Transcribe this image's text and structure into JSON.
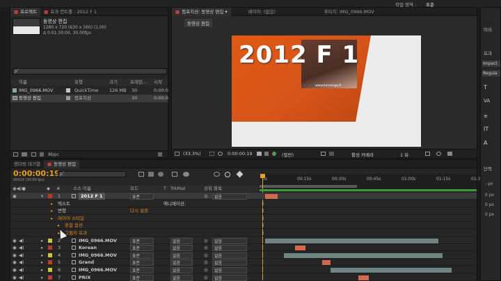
{
  "top_menu": {
    "workspace_label": "작업 영역 :",
    "workspace_value": "표준"
  },
  "project_panel": {
    "tabs": [
      "프로젝트",
      "효과 컨트롤 : 2012 F 1"
    ],
    "comp_name": "동영상 편집",
    "comp_dims": "1280 x 720  (630 x 360) (1.00)",
    "comp_duration": "Δ 0:01:30:00, 30.00fps",
    "search_placeholder": "ρ˜",
    "columns": [
      "이름",
      "유형",
      "크기",
      "프레임...",
      "시작"
    ],
    "items": [
      {
        "name": "IMG_0966.MOV",
        "type": "QuickTime",
        "size": "126 MB",
        "fps": "30",
        "start": "0:00:0"
      },
      {
        "name": "동영상 편집",
        "type": "컴포지션",
        "size": "",
        "fps": "30",
        "start": "0:00:0"
      }
    ],
    "bpc": "8bpc"
  },
  "viewer_panel": {
    "tabs": [
      "컴포지션: 동영상 편집",
      "레이어: (없음)",
      "푸티지: IMG_0966.MOV"
    ],
    "breadcrumb": "동영상 편집",
    "frame_title": "2012 F 1",
    "frame_url": "www.koreanga.fr",
    "zoom": "(33.3%)",
    "timecode": "0:00:00:19",
    "resolution": "(절반)",
    "camera": "활성 카메라",
    "views": "1 뷰"
  },
  "right_panel": {
    "top_tabs": [
      "미리"
    ],
    "effects_tab": "효과",
    "items": [
      "Impact",
      "Regula"
    ],
    "bottom_tab": "단락",
    "px_values": [
      "- px",
      "0 px",
      "0 px",
      "0 px"
    ]
  },
  "timeline": {
    "tabs": [
      "렌더링 대기열",
      "동영상 편집"
    ],
    "timecode": "0:00:00:19",
    "timecode_sub": "00019 (30.00 fps)",
    "search_placeholder": "ρ˜",
    "columns": {
      "num": "#",
      "name": "소스 이름",
      "mode": "모드",
      "t": "T",
      "trkmat": "TrkMat",
      "parent": "상위 항목"
    },
    "ruler_ticks": [
      "0s",
      "00:15s",
      "00:30s",
      "00:45s",
      "01:00s",
      "01:15s",
      "01:3"
    ],
    "rows": [
      {
        "num": "1",
        "name": "2012 F 1",
        "kind": "layer",
        "color": "#c0392b",
        "mode": "표준",
        "trkmat": "",
        "parent": "없음",
        "bar_start": 0.0,
        "bar_end": 0.06,
        "bar_color": "#d4694b"
      },
      {
        "num": "",
        "name": "텍스트",
        "kind": "prop1",
        "color": "",
        "mode": "",
        "trkmat": "",
        "parent": "",
        "extra": "애니메이션:"
      },
      {
        "num": "",
        "name": "변형",
        "kind": "prop1",
        "color": "",
        "mode": "",
        "trkmat": "",
        "parent": "",
        "extra": "다시 설정"
      },
      {
        "num": "",
        "name": "레이어 스타일",
        "kind": "prop1",
        "color": "",
        "mode": "",
        "trkmat": "",
        "parent": "",
        "extra": ""
      },
      {
        "num": "",
        "name": "혼합 옵션",
        "kind": "prop2",
        "color": "",
        "mode": "",
        "trkmat": "",
        "parent": "",
        "extra": ""
      },
      {
        "num": "",
        "name": "그림자 효과",
        "kind": "prop2",
        "color": "",
        "mode": "",
        "trkmat": "",
        "parent": "",
        "extra": ""
      },
      {
        "num": "2",
        "name": "IMG_0966.MOV",
        "kind": "layer",
        "color": "#c8c83c",
        "mode": "표준",
        "trkmat": "없음",
        "parent": "없음",
        "bar_start": 0.0,
        "bar_end": 0.82,
        "bar_color": "#6f8583"
      },
      {
        "num": "3",
        "name": "Korean",
        "kind": "layer",
        "color": "#c0392b",
        "mode": "표준",
        "trkmat": "없음",
        "parent": "없음",
        "bar_start": 0.14,
        "bar_end": 0.19,
        "bar_color": "#d4694b"
      },
      {
        "num": "4",
        "name": "IMG_0966.MOV",
        "kind": "layer",
        "color": "#c8c83c",
        "mode": "표준",
        "trkmat": "없음",
        "parent": "없음",
        "bar_start": 0.09,
        "bar_end": 0.84,
        "bar_color": "#6f8583"
      },
      {
        "num": "5",
        "name": "Grand",
        "kind": "layer",
        "color": "#c0392b",
        "mode": "표준",
        "trkmat": "없음",
        "parent": "없음",
        "bar_start": 0.27,
        "bar_end": 0.31,
        "bar_color": "#d4694b"
      },
      {
        "num": "6",
        "name": "IMG_0966.MOV",
        "kind": "layer",
        "color": "#c8c83c",
        "mode": "표준",
        "trkmat": "없음",
        "parent": "없음",
        "bar_start": 0.31,
        "bar_end": 0.88,
        "bar_color": "#6f8583"
      },
      {
        "num": "7",
        "name": "PRIX",
        "kind": "layer",
        "color": "#c0392b",
        "mode": "표준",
        "trkmat": "없음",
        "parent": "없음",
        "bar_start": 0.44,
        "bar_end": 0.49,
        "bar_color": "#d4694b"
      }
    ]
  },
  "colors": {
    "accent_orange": "#e08a1e",
    "timecode_orange": "#e8a020"
  }
}
